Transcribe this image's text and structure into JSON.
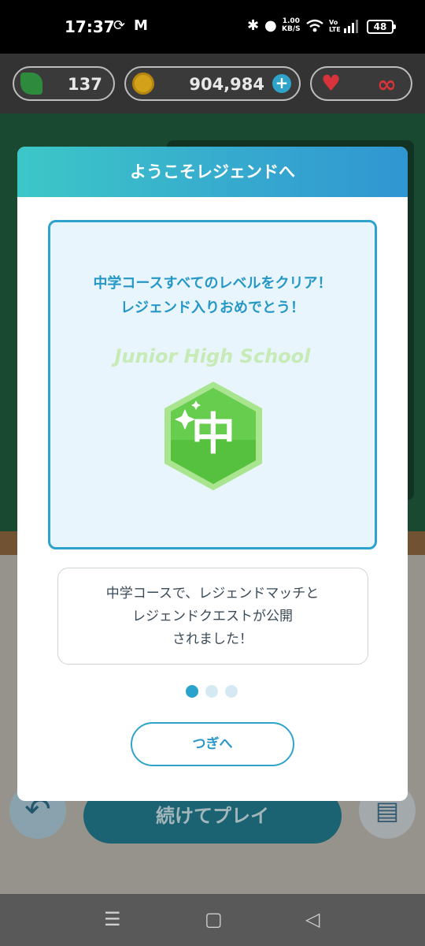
{
  "status_bar": {
    "time": "17:37",
    "speed_value": "1.00",
    "speed_unit": "KB/S",
    "volte_1": "Vo",
    "volte_2": "LTE",
    "battery": "48"
  },
  "currency_bar": {
    "leaves": "137",
    "coins": "904,984",
    "plus": "+",
    "hearts": "∞"
  },
  "background": {
    "continue_button": "続けてプレイ"
  },
  "modal": {
    "title": "ようこそレジェンドへ",
    "card": {
      "message_line1": "中学コースすべてのレベルをクリア！",
      "message_line2": "レジェンド入りおめでとう！",
      "badge_caption": "Junior High School",
      "badge_character": "中"
    },
    "info": {
      "line1": "中学コースで、レジェンドマッチと",
      "line2": "レジェンドクエストが公開",
      "line3": "されました！"
    },
    "pagination": {
      "current": 1,
      "total": 3
    },
    "next_button": "つぎへ"
  },
  "colors": {
    "accent": "#2ea2cf",
    "header_gradient_start": "#3cc7c7",
    "badge_green": "#5cc94a",
    "heart": "#d6333b"
  }
}
